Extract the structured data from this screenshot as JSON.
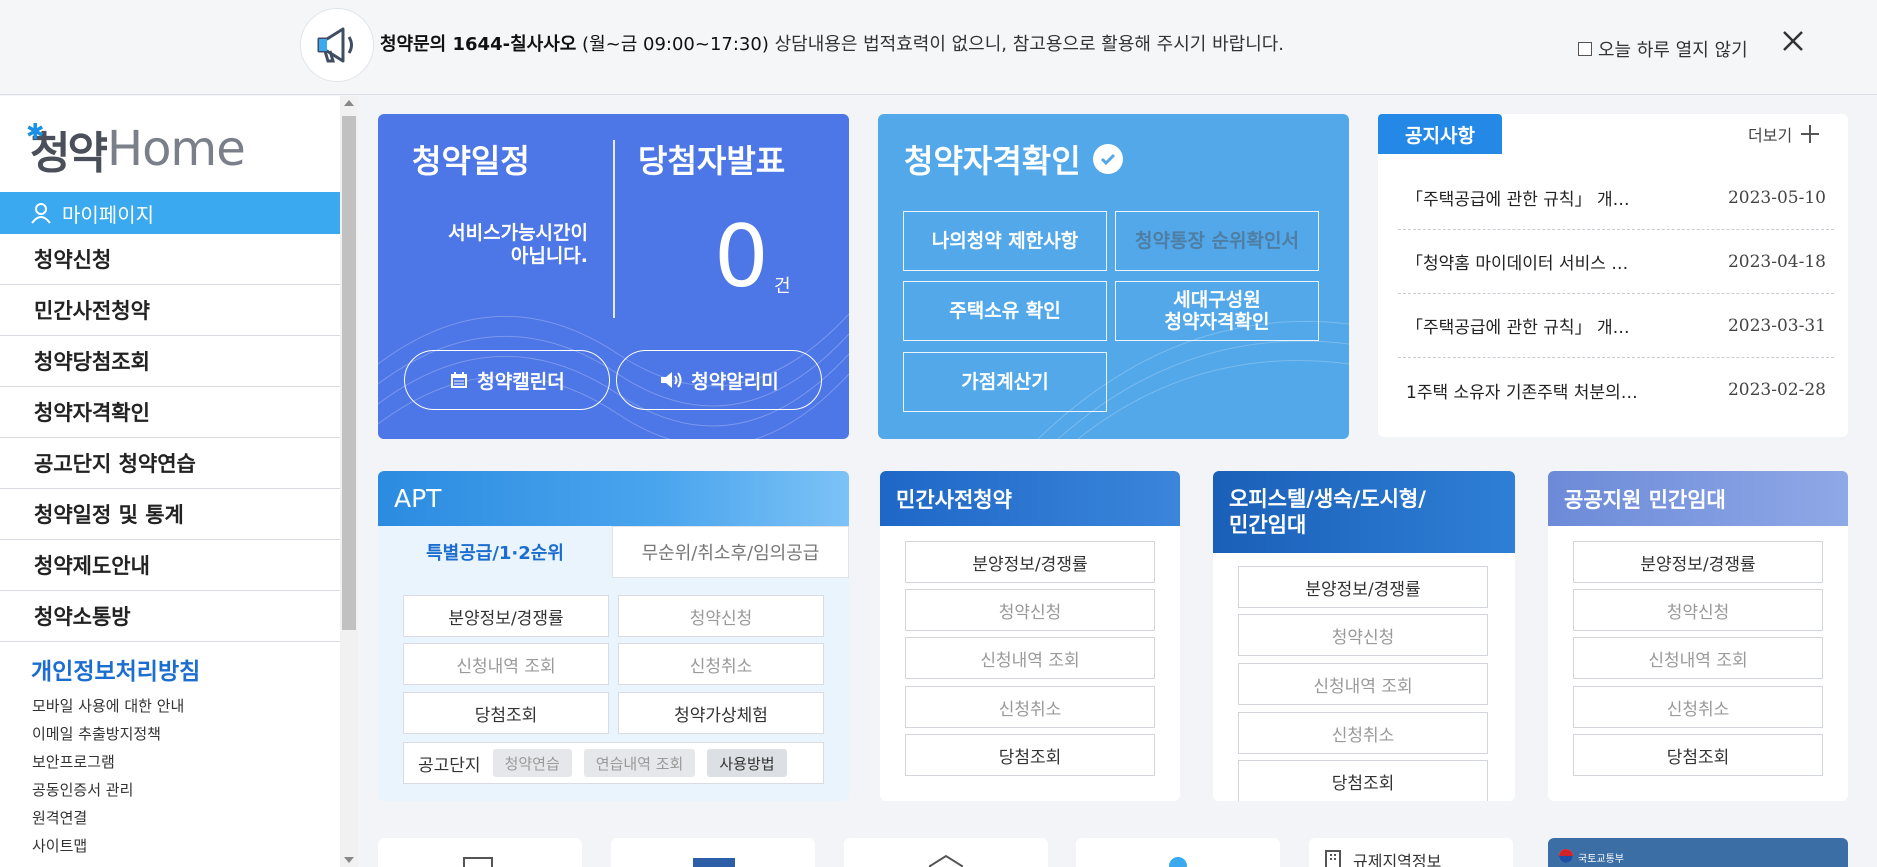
{
  "notice_bar": {
    "lead": "청약문의 1644-칠사사오",
    "hours": " (월~금 09:00~17:30)",
    "message": " 상담내용은 법적효력이 없으니, 참고용으로 활용해 주시기 바랍니다.",
    "no_show_today": "오늘 하루 열지 않기"
  },
  "sidebar": {
    "logo_ko": "청약",
    "logo_en": "Home",
    "mypage": "마이페이지",
    "menu": [
      "청약신청",
      "민간사전청약",
      "청약당첨조회",
      "청약자격확인",
      "공고단지 청약연습",
      "청약일정 및 통계",
      "청약제도안내",
      "청약소통방"
    ],
    "privacy": "개인정보처리방침",
    "links": [
      "모바일 사용에 대한 안내",
      "이메일 추출방지정책",
      "보안프로그램",
      "공동인증서 관리",
      "원격연결",
      "사이트맵"
    ]
  },
  "schedule_card": {
    "title1": "청약일정",
    "title2": "당첨자발표",
    "message_line1": "서비스가능시간이",
    "message_line2": "아닙니다.",
    "count": "0",
    "unit": "건",
    "calendar_btn": "청약캘린더",
    "alarm_btn": "청약알리미"
  },
  "qualification_card": {
    "title": "청약자격확인",
    "buttons": [
      "나의청약 제한사항",
      "청약통장 순위확인서",
      "주택소유 확인",
      "세대구성원",
      "청약자격확인",
      "가점계산기"
    ]
  },
  "notice_card": {
    "tab": "공지사항",
    "more": "더보기",
    "items": [
      {
        "title": "「주택공급에 관한 규칙」 개…",
        "date": "2023-05-10"
      },
      {
        "title": "「청약홈 마이데이터 서비스 …",
        "date": "2023-04-18"
      },
      {
        "title": "「주택공급에 관한 규칙」 개…",
        "date": "2023-03-31"
      },
      {
        "title": "1주택 소유자 기존주택 처분의…",
        "date": "2023-02-28"
      }
    ]
  },
  "apt_panel": {
    "title": "APT",
    "tab_active": "특별공급/1·2순위",
    "tab_inactive": "무순위/취소후/임의공급",
    "buttons": [
      "분양정보/경쟁률",
      "청약신청",
      "신청내역 조회",
      "신청취소",
      "당첨조회",
      "청약가상체험"
    ],
    "row_label": "공고단지",
    "chips": [
      "청약연습",
      "연습내역 조회",
      "사용방법"
    ]
  },
  "presale_panel": {
    "title": "민간사전청약",
    "buttons": [
      "분양정보/경쟁률",
      "청약신청",
      "신청내역 조회",
      "신청취소",
      "당첨조회"
    ]
  },
  "officetel_panel": {
    "title_line1": "오피스텔/생숙/도시형/",
    "title_line2": "민간임대",
    "buttons": [
      "분양정보/경쟁률",
      "청약신청",
      "신청내역 조회",
      "신청취소",
      "당첨조회"
    ]
  },
  "public_rental_panel": {
    "title": "공공지원 민간임대",
    "buttons": [
      "분양정보/경쟁률",
      "청약신청",
      "신청내역 조회",
      "신청취소",
      "당첨조회"
    ]
  },
  "bottom_row": {
    "regulated_area": "규제지역정보",
    "ministry": "국토교통부"
  },
  "colors": {
    "schedule_bg": "#4d76e6",
    "qualification_bg": "#53a8ea",
    "accent_blue": "#2488e6",
    "mypage_bg": "#3aa9f0"
  },
  "icons": [
    "megaphone-icon",
    "close-icon",
    "user-icon",
    "calendar-icon",
    "speaker-icon",
    "check-circle-icon",
    "plus-icon",
    "document-icon",
    "building-icon"
  ]
}
